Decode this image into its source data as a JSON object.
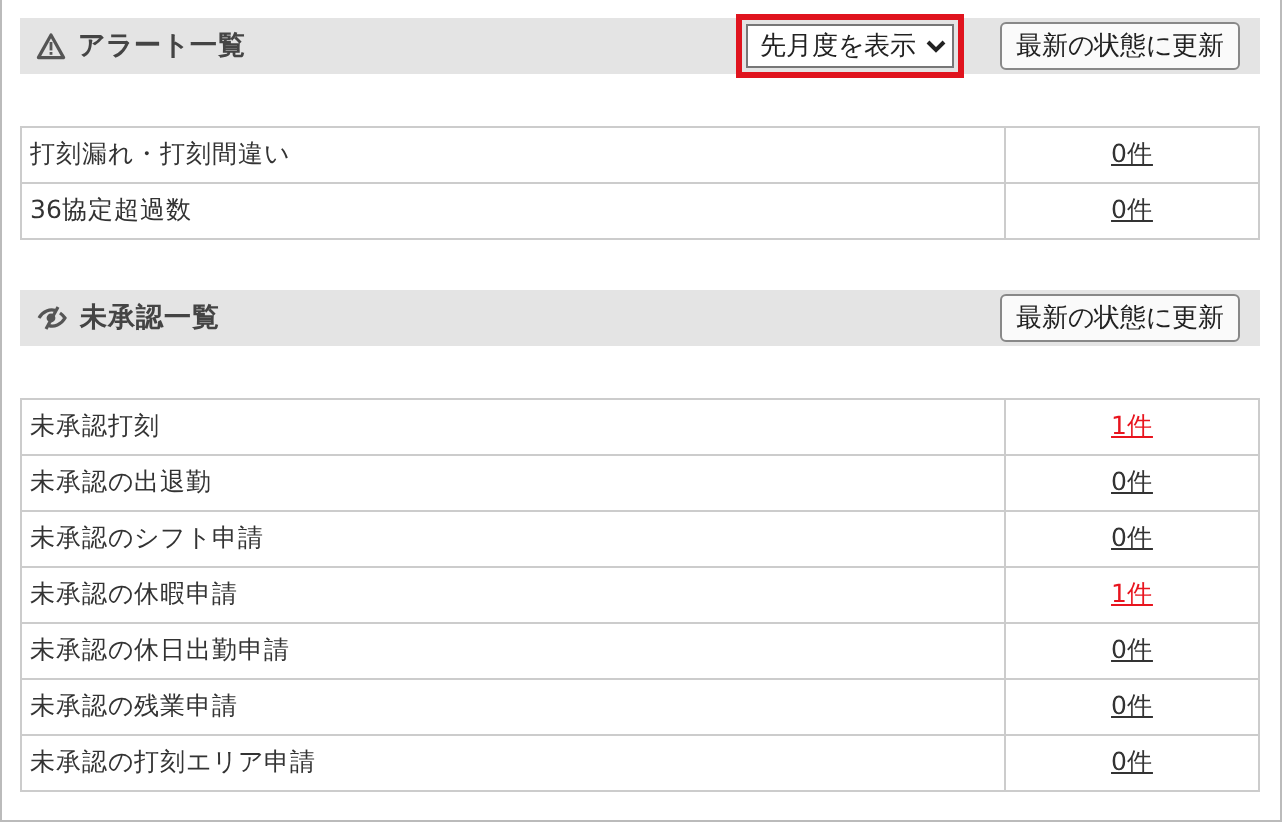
{
  "sections": [
    {
      "kind": "alert",
      "title": "アラート一覧",
      "period_select": {
        "value": "先月度を表示",
        "highlighted": true
      },
      "refresh_button": "最新の状態に更新",
      "rows": [
        {
          "label": "打刻漏れ・打刻間違い",
          "count": "0件",
          "attention": false
        },
        {
          "label": "36協定超過数",
          "count": "0件",
          "attention": false
        }
      ]
    },
    {
      "kind": "unapproved",
      "title": "未承認一覧",
      "refresh_button": "最新の状態に更新",
      "rows": [
        {
          "label": "未承認打刻",
          "count": "1件",
          "attention": true
        },
        {
          "label": "未承認の出退勤",
          "count": "0件",
          "attention": false
        },
        {
          "label": "未承認のシフト申請",
          "count": "0件",
          "attention": false
        },
        {
          "label": "未承認の休暇申請",
          "count": "1件",
          "attention": true
        },
        {
          "label": "未承認の休日出勤申請",
          "count": "0件",
          "attention": false
        },
        {
          "label": "未承認の残業申請",
          "count": "0件",
          "attention": false
        },
        {
          "label": "未承認の打刻エリア申請",
          "count": "0件",
          "attention": false
        }
      ]
    }
  ]
}
